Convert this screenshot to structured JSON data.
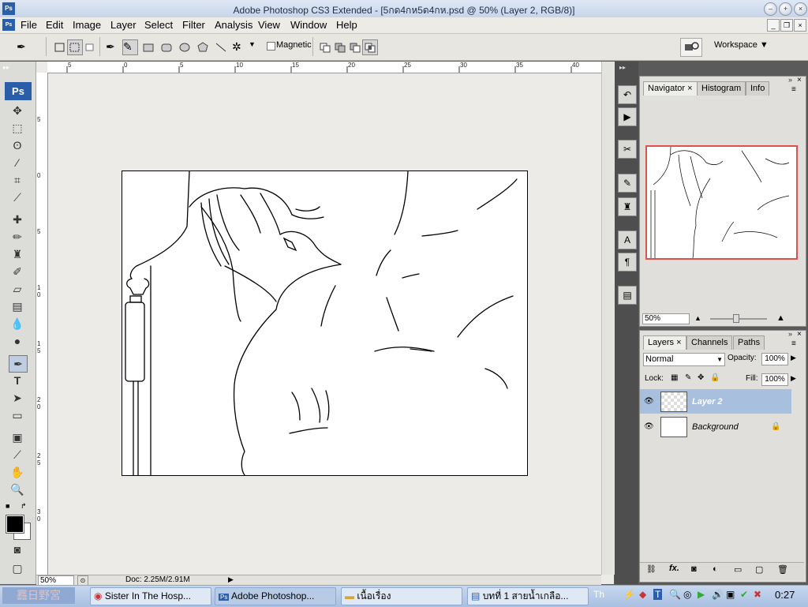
{
  "window": {
    "title": "Adobe Photoshop CS3 Extended - [5กด4กห5ด4กห.psd @ 50% (Layer 2, RGB/8)]"
  },
  "menu": [
    "File",
    "Edit",
    "Image",
    "Layer",
    "Select",
    "Filter",
    "Analysis",
    "View",
    "Window",
    "Help"
  ],
  "options": {
    "magnetic_label": "Magnetic",
    "workspace_label": "Workspace"
  },
  "toolbox": {
    "badge": "Ps"
  },
  "ruler": {
    "top": [
      "5",
      "0",
      "5",
      "10",
      "15",
      "20",
      "25",
      "30",
      "35",
      "40"
    ],
    "left": [
      "5",
      "0",
      "5",
      "1 0",
      "1 5",
      "2 0",
      "2 5",
      "3 0"
    ]
  },
  "status": {
    "zoom": "50%",
    "doc": "Doc: 2.25M/2.91M"
  },
  "navigator": {
    "tabs": [
      "Navigator",
      "Histogram",
      "Info"
    ],
    "zoom": "50%"
  },
  "layers": {
    "tabs": [
      "Layers",
      "Channels",
      "Paths"
    ],
    "blend_mode": "Normal",
    "opacity_label": "Opacity:",
    "opacity": "100%",
    "lock_label": "Lock:",
    "fill_label": "Fill:",
    "fill": "100%",
    "items": [
      {
        "name": "Layer 2",
        "selected": true
      },
      {
        "name": "Background",
        "locked": true
      }
    ]
  },
  "taskbar": {
    "tasks": [
      "Sister In The Hosp...",
      "Adobe Photoshop...",
      "เนื้อเรื่อง",
      "บทที่ 1 สายน้ำเกลือ..."
    ],
    "clock": "0:27"
  },
  "colors": {
    "accent": "#2a5ea8",
    "selected_layer": "#a9bfde",
    "nav_frame": "#d9534f"
  }
}
